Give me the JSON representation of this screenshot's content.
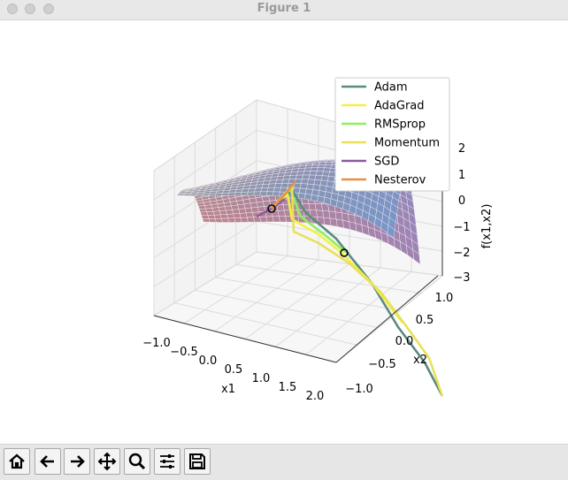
{
  "window": {
    "title": "Figure 1"
  },
  "toolbar": {
    "buttons": [
      {
        "icon": "home-icon"
      },
      {
        "icon": "back-arrow-icon"
      },
      {
        "icon": "forward-arrow-icon"
      },
      {
        "icon": "pan-icon"
      },
      {
        "icon": "zoom-icon"
      },
      {
        "icon": "configure-subplots-icon"
      },
      {
        "icon": "save-icon"
      }
    ]
  },
  "chart_data": {
    "type": "3d-surface",
    "xlabel": "x1",
    "ylabel": "x2",
    "zlabel": "f(x1,x2)",
    "xticks": [
      "−1.0",
      "−0.5",
      "0.0",
      "0.5",
      "1.0",
      "1.5",
      "2.0"
    ],
    "yticks": [
      "−1.0",
      "−0.5",
      "0.0",
      "0.5",
      "1.0"
    ],
    "zticks": [
      "−3",
      "−2",
      "−1",
      "0",
      "1",
      "2"
    ],
    "xlim": [
      -1.0,
      2.0
    ],
    "ylim": [
      -1.0,
      1.0
    ],
    "zlim": [
      -3,
      2
    ],
    "legend_position": "top-right",
    "legend": [
      {
        "name": "Adam",
        "color": "#5b8a80"
      },
      {
        "name": "AdaGrad",
        "color": "#f4f046"
      },
      {
        "name": "RMSprop",
        "color": "#8ef05a"
      },
      {
        "name": "Momentum",
        "color": "#e8e05a"
      },
      {
        "name": "SGD",
        "color": "#8a5aa0"
      },
      {
        "name": "Nesterov",
        "color": "#e89040"
      }
    ]
  }
}
